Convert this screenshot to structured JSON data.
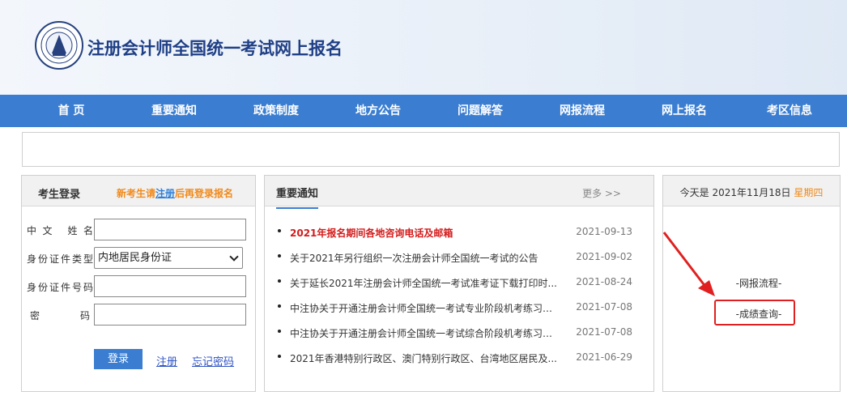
{
  "header": {
    "title": "注册会计师全国统一考试网上报名"
  },
  "nav": [
    "首 页",
    "重要通知",
    "政策制度",
    "地方公告",
    "问题解答",
    "网报流程",
    "网上报名",
    "考区信息"
  ],
  "login": {
    "title": "考生登录",
    "hint_pre": "新考生请",
    "hint_link": "注册",
    "hint_post": "后再登录报名",
    "name_label": "中文 姓名",
    "idtype_label": "身份证件类型",
    "idtype_value": "内地居民身份证",
    "idno_label": "身份证件号码",
    "password_label": "密 码",
    "name_value": "",
    "idno_value": "",
    "password_value": "",
    "login_btn": "登录",
    "register_link": "注册",
    "forgot_link": "忘记密码"
  },
  "news": {
    "title": "重要通知",
    "more": "更多 >>",
    "items": [
      {
        "text": "2021年报名期间各地咨询电话及邮箱",
        "date": "2021-09-13"
      },
      {
        "text": "关于2021年另行组织一次注册会计师全国统一考试的公告",
        "date": "2021-09-02"
      },
      {
        "text": "关于延长2021年注册会计师全国统一考试准考证下载打印时...",
        "date": "2021-08-24"
      },
      {
        "text": "中注协关于开通注册会计师全国统一考试专业阶段机考练习网站...",
        "date": "2021-07-08"
      },
      {
        "text": "中注协关于开通注册会计师全国统一考试综合阶段机考练习网站...",
        "date": "2021-07-08"
      },
      {
        "text": "2021年香港特别行政区、澳门特别行政区、台湾地区居民及...",
        "date": "2021-06-29"
      }
    ]
  },
  "side": {
    "today_pre": "今天是 2021年11月18日",
    "weekday": "星期四",
    "link1": "-网报流程-",
    "link2": "-成绩查询-"
  },
  "colors": {
    "nav": "#3b7ed1",
    "title": "#1f3f86",
    "hot": "#d31b1b",
    "accent": "#f08a1c",
    "highlight": "#e02020"
  }
}
